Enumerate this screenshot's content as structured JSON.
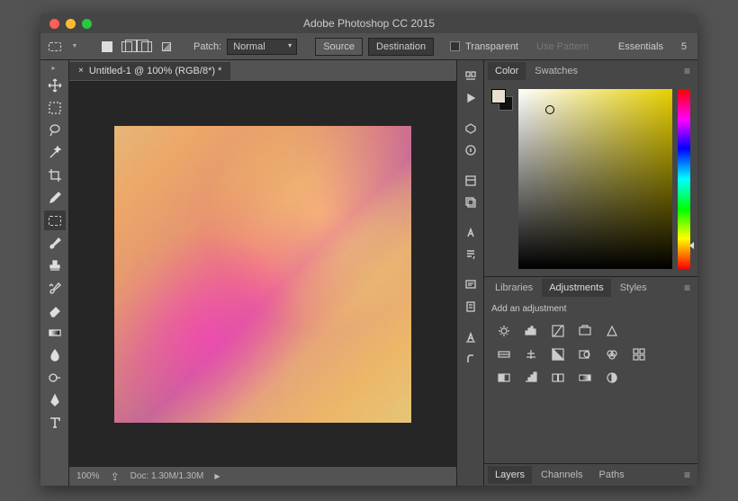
{
  "title": "Adobe Photoshop CC 2015",
  "options": {
    "patch_label": "Patch:",
    "patch_mode": "Normal",
    "source": "Source",
    "destination": "Destination",
    "transparent": "Transparent",
    "use_pattern": "Use Pattern",
    "workspace": "Essentials",
    "value": "5"
  },
  "doc": {
    "tab": "Untitled-1 @ 100% (RGB/8*) *"
  },
  "status": {
    "zoom": "100%",
    "doc": "Doc: 1.30M/1.30M"
  },
  "panels": {
    "color": "Color",
    "swatches": "Swatches",
    "libraries": "Libraries",
    "adjustments": "Adjustments",
    "styles": "Styles",
    "add_adj": "Add an adjustment",
    "layers": "Layers",
    "channels": "Channels",
    "paths": "Paths"
  }
}
